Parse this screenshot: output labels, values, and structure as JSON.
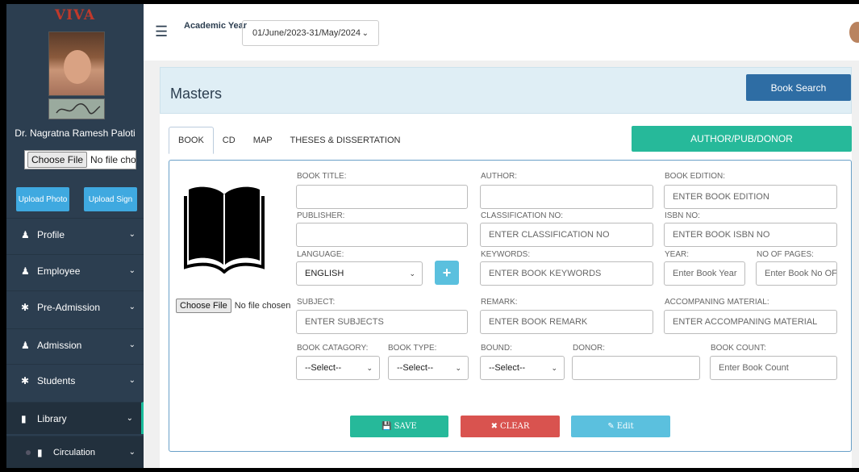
{
  "sidebar": {
    "brand": "VIVA",
    "user_name": "Dr. Nagratna Ramesh Paloti",
    "file_input": {
      "button": "Choose File",
      "status": "No file chosen"
    },
    "upload_photo": "Upload Photo",
    "upload_sign": "Upload Sign",
    "items": [
      {
        "label": "Profile",
        "icon": "user-plus-icon"
      },
      {
        "label": "Employee",
        "icon": "user-icon"
      },
      {
        "label": "Pre-Admission",
        "icon": "asterisk-icon"
      },
      {
        "label": "Admission",
        "icon": "users-icon"
      },
      {
        "label": "Students",
        "icon": "asterisk-icon"
      },
      {
        "label": "Library",
        "icon": "book-icon"
      },
      {
        "label": "Circulation",
        "icon": "book-icon"
      }
    ]
  },
  "header": {
    "academic_year_label": "Academic Year",
    "academic_year_value": "01/June/2023-31/May/2024"
  },
  "main": {
    "title": "Masters",
    "book_search": "Book Search",
    "tabs": [
      {
        "label": "BOOK"
      },
      {
        "label": "CD"
      },
      {
        "label": "MAP"
      },
      {
        "label": "THESES & DISSERTATION"
      }
    ],
    "author_pub_donor": "AUTHOR/PUB/DONOR",
    "file_input": {
      "button": "Choose File",
      "status": "No file chosen"
    },
    "fields": {
      "book_title": {
        "label": "BOOK TITLE:",
        "value": ""
      },
      "author": {
        "label": "AUTHOR:",
        "value": ""
      },
      "book_edition": {
        "label": "BOOK EDITION:",
        "placeholder": "ENTER BOOK EDITION"
      },
      "publisher": {
        "label": "PUBLISHER:",
        "value": ""
      },
      "classification_no": {
        "label": "CLASSIFICATION NO:",
        "placeholder": "ENTER CLASSIFICATION NO"
      },
      "isbn_no": {
        "label": "ISBN NO:",
        "placeholder": "ENTER BOOK ISBN NO"
      },
      "language": {
        "label": "LANGUAGE:",
        "value": "ENGLISH"
      },
      "keywords": {
        "label": "KEYWORDS:",
        "placeholder": "ENTER BOOK KEYWORDS"
      },
      "year": {
        "label": "YEAR:",
        "placeholder": "Enter Book Year"
      },
      "no_of_pages": {
        "label": "NO OF PAGES:",
        "placeholder": "Enter Book No OF"
      },
      "subject": {
        "label": "SUBJECT:",
        "placeholder": "ENTER SUBJECTS"
      },
      "remark": {
        "label": "REMARK:",
        "placeholder": "ENTER BOOK REMARK"
      },
      "accompaning_material": {
        "label": "ACCOMPANING MATERIAL:",
        "placeholder": "ENTER ACCOMPANING MATERIAL"
      },
      "book_category": {
        "label": "BOOK CATAGORY:",
        "value": "--Select--"
      },
      "book_type": {
        "label": "BOOK TYPE:",
        "value": "--Select--"
      },
      "bound": {
        "label": "BOUND:",
        "value": "--Select--"
      },
      "donor": {
        "label": "DONOR:",
        "value": ""
      },
      "book_count": {
        "label": "BOOK COUNT:",
        "placeholder": "Enter Book Count"
      }
    },
    "actions": {
      "save": "SAVE",
      "clear": "CLEAR",
      "edit": "Edit"
    }
  },
  "colors": {
    "sidebar": "#2c3e50",
    "accent_green": "#26b99a",
    "primary_blue": "#2e6da4",
    "danger_red": "#d9534f",
    "info_blue": "#5bc0de"
  }
}
